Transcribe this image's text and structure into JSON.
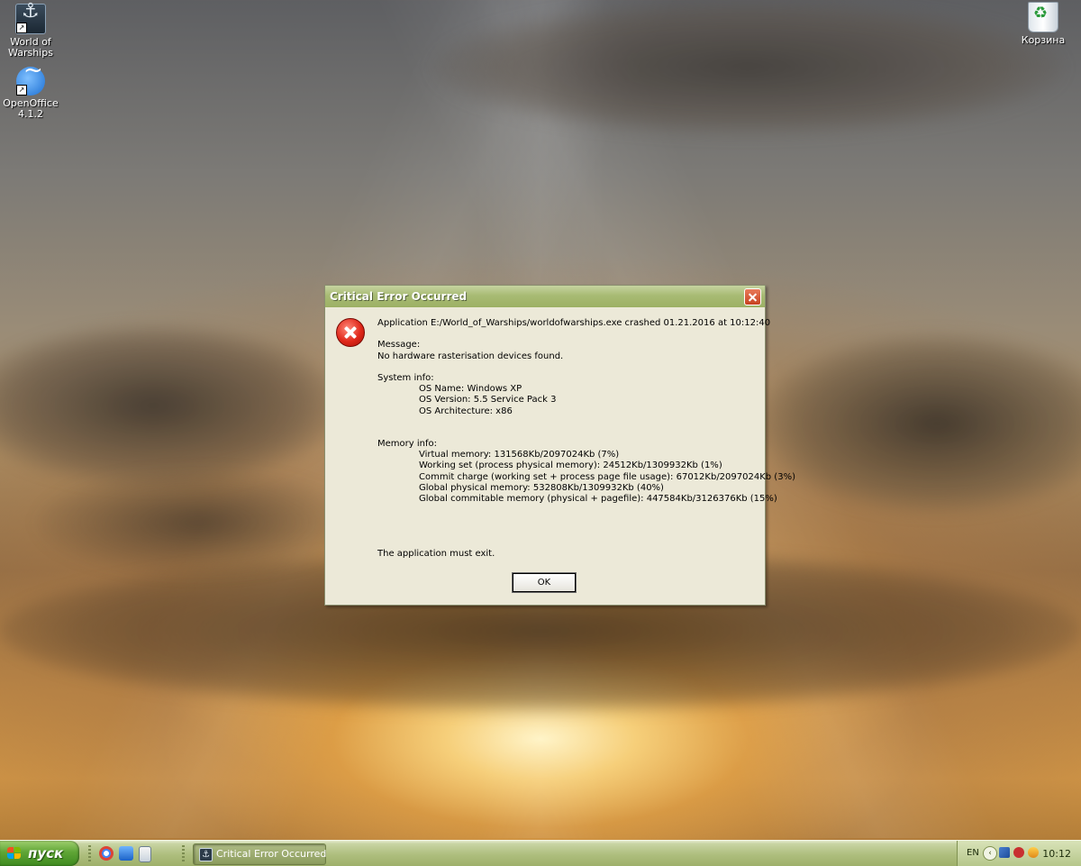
{
  "desktop": {
    "icons": [
      {
        "label_line1": "World of",
        "label_line2": "Warships"
      },
      {
        "label_line1": "OpenOffice",
        "label_line2": "4.1.2"
      },
      {
        "label_line1": "Корзина",
        "label_line2": ""
      }
    ]
  },
  "dialog": {
    "title": "Critical Error Occurred",
    "lines": {
      "application": "Application E:/World_of_Warships/worldofwarships.exe crashed 01.21.2016 at 10:12:40",
      "message_label": "Message:",
      "message": "No hardware rasterisation devices found.",
      "system_label": "System info:",
      "os_name": "OS Name: Windows XP",
      "os_version": "OS Version: 5.5 Service Pack 3",
      "os_arch": "OS Architecture: x86",
      "memory_label": "Memory info:",
      "virtual_memory": "Virtual memory: 131568Kb/2097024Kb (7%)",
      "working_set": "Working set (process physical memory): 24512Kb/1309932Kb (1%)",
      "commit_charge": "Commit charge (working set + process page file usage): 67012Kb/2097024Kb (3%)",
      "global_physical": "Global physical memory: 532808Kb/1309932Kb (40%)",
      "global_commitable": "Global commitable memory (physical + pagefile): 447584Kb/3126376Kb (15%)",
      "exit": "The application must exit."
    },
    "ok_label": "OK"
  },
  "taskbar": {
    "start_label": "пуск",
    "task_label": "Critical Error Occurred",
    "lang": "EN",
    "clock": "10:12"
  }
}
